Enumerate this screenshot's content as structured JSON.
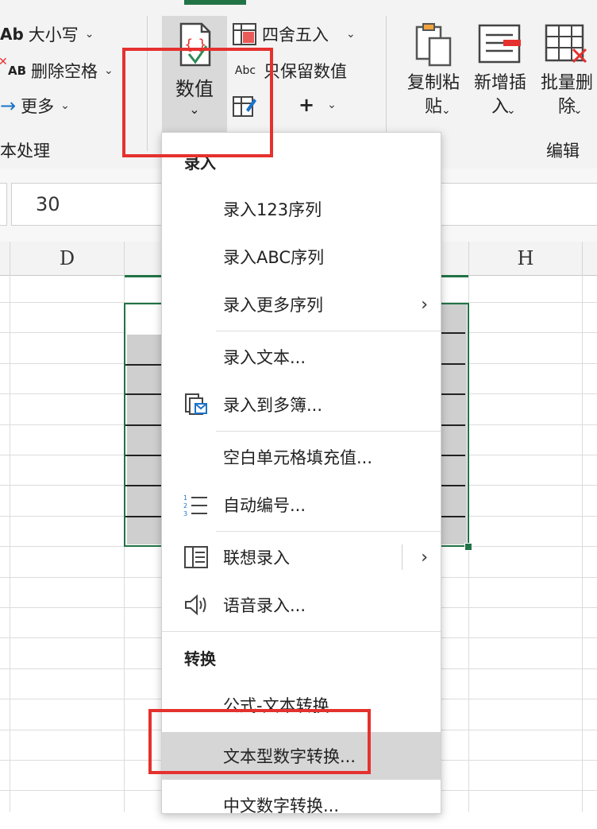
{
  "ribbon": {
    "case_label": "大小写",
    "case_icon": "Ab",
    "delete_spaces_label": "删除空格",
    "delete_spaces_icon": "AB",
    "more_label": "更多",
    "group_text_label": "本处理",
    "numeric_label": "数值",
    "round_label": "四舍五入",
    "keep_values_label": "只保留数值",
    "keep_values_icon": "Abc",
    "plus_label": "+",
    "copy_paste_label": "复制粘\n贴",
    "insert_label": "新增插\n入",
    "batch_delete_label": "批量删\n除",
    "group_edit_label": "编辑"
  },
  "formula_bar": {
    "value": "30"
  },
  "sheet": {
    "columns": [
      "D",
      "H"
    ]
  },
  "menu": {
    "section_input": "录入",
    "items_input": [
      {
        "label": "录入123序列"
      },
      {
        "label": "录入ABC序列"
      },
      {
        "label": "录入更多序列"
      },
      {
        "label": "录入文本..."
      },
      {
        "label": "录入到多簿..."
      },
      {
        "label": "空白单元格填充值..."
      },
      {
        "label": "自动编号..."
      },
      {
        "label": "联想录入"
      },
      {
        "label": "语音录入..."
      }
    ],
    "section_convert": "转换",
    "items_convert": [
      {
        "label": "公式-文本转换..."
      },
      {
        "label": "文本型数字转换..."
      },
      {
        "label": "中文数字转换..."
      }
    ]
  },
  "colors": {
    "highlight_red": "#e5312e",
    "selection_green": "#217346"
  }
}
